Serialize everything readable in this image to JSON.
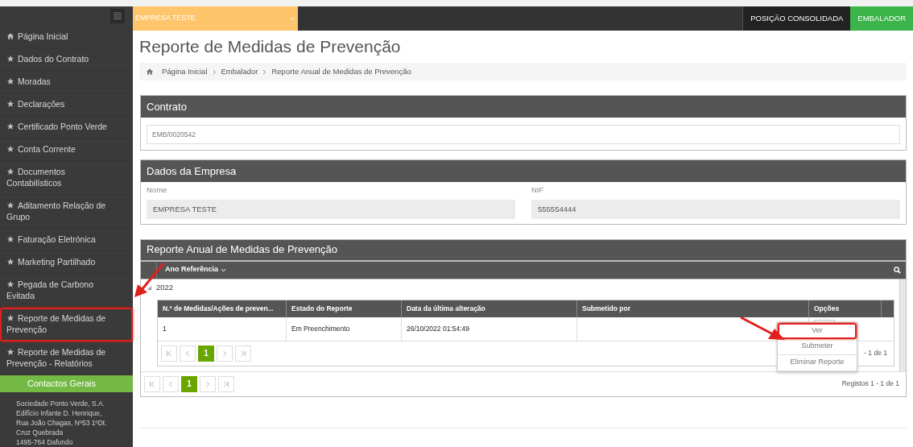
{
  "sidebar": {
    "items": [
      {
        "label": "Página Inicial",
        "highlighted": false
      },
      {
        "label": "Dados do Contrato",
        "highlighted": false
      },
      {
        "label": "Moradas",
        "highlighted": false
      },
      {
        "label": "Declarações",
        "highlighted": false
      },
      {
        "label": "Certificado Ponto Verde",
        "highlighted": false
      },
      {
        "label": "Conta Corrente",
        "highlighted": false
      },
      {
        "label": "Documentos Contabilísticos",
        "highlighted": false
      },
      {
        "label": "Aditamento Relação de Grupo",
        "highlighted": false
      },
      {
        "label": "Faturação Eletrónica",
        "highlighted": false
      },
      {
        "label": "Marketing Partilhado",
        "highlighted": false
      },
      {
        "label": "Pegada de Carbono Evitada",
        "highlighted": false
      },
      {
        "label": "Reporte de Medidas de Prevenção",
        "highlighted": true
      },
      {
        "label": "Reporte de Medidas de Prevenção - Relatórios",
        "highlighted": false
      }
    ],
    "contacts_title": "Contactos Gerais",
    "address": [
      "Sociedade Ponto Verde, S.A.",
      "Edifício Infante D. Henrique,",
      "Rua João Chagas, Nº53 1ºDt.",
      "Cruz Quebrada",
      "1495-764 Dafundo"
    ]
  },
  "top_bar": {
    "company": "EMPRESA TESTE",
    "tabs": [
      {
        "label": "POSIÇÃO CONSOLIDADA",
        "selected": false
      },
      {
        "label": "EMBALADOR",
        "selected": true
      }
    ]
  },
  "page_title": "Reporte de Medidas de Prevenção",
  "breadcrumb": [
    "Página Inicial",
    "Embalador",
    "Reporte Anual de Medidas de Prevenção"
  ],
  "contract_panel": {
    "title": "Contrato",
    "value": "EMB/0020542"
  },
  "company_panel": {
    "title": "Dados da Empresa",
    "fields": [
      {
        "label": "Nome",
        "value": "EMPRESA TESTE"
      },
      {
        "label": "NIF",
        "value": "555554444"
      }
    ]
  },
  "report_panel": {
    "title": "Reporte Anual de Medidas de Prevenção",
    "group_header": "Ano Referência",
    "group": "2022",
    "table": {
      "columns": [
        "N.º de Medidas/Ações de preven...",
        "Estado do Reporte",
        "Data da última alteração",
        "Submetido por",
        "Opções"
      ],
      "rows": [
        [
          "1",
          "Em Preenchimento",
          "26/10/2022 01:54:49",
          ""
        ]
      ]
    },
    "inner_pager": {
      "pages": [
        {
          "label": "1",
          "selected": true
        }
      ],
      "info": "- 1 de 1"
    },
    "outer_pager": {
      "pages": [
        {
          "label": "1",
          "selected": true
        }
      ],
      "info": "Registos 1 - 1 de 1"
    },
    "options_menu": [
      {
        "label": "Ver",
        "highlighted": true
      },
      {
        "label": "Submeter",
        "highlighted": false
      },
      {
        "label": "Eliminar Reporte",
        "highlighted": false
      }
    ]
  }
}
